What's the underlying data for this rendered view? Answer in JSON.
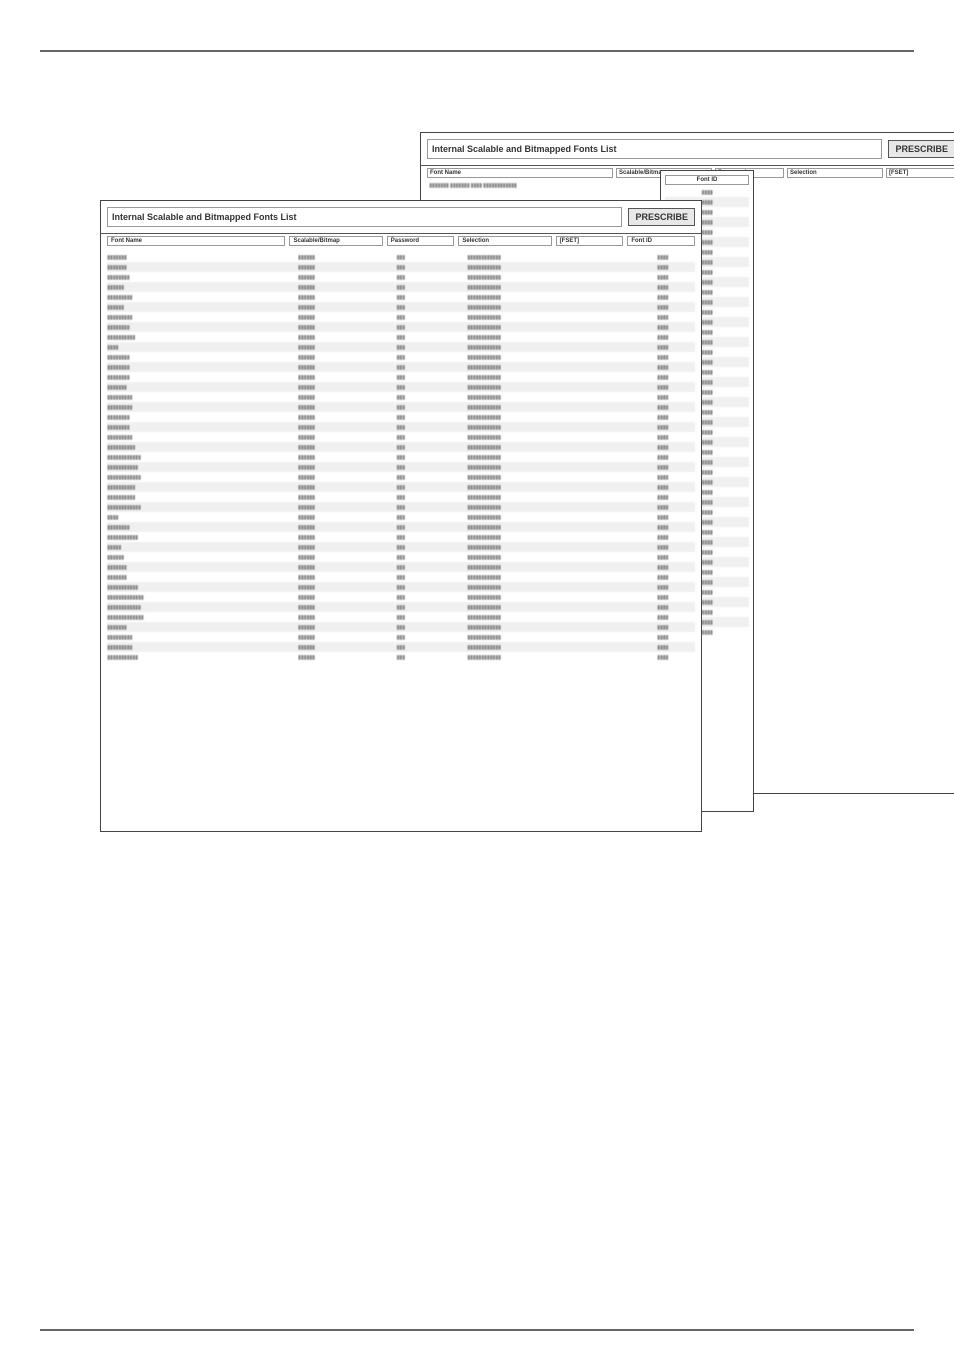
{
  "title": "Internal Scalable and Bitmapped Fonts List",
  "prescribe": "PRESCRIBE",
  "headers": {
    "name": "Font Name",
    "sb": "Scalable/Bitmap",
    "pw": "Password",
    "sel": "Selection",
    "fset": "[FSET]",
    "fid": "Font ID"
  },
  "rows": [
    {
      "name": "▮▮▮▮▮▮▮",
      "sb": "▮▮▮▮▮▮",
      "pw": "▮▮▮",
      "sel": "▮▮▮▮▮▮▮▮▮▮▮▮",
      "fid": "▮▮▮▮"
    },
    {
      "name": "▮▮▮▮▮▮▮",
      "sb": "▮▮▮▮▮▮",
      "pw": "▮▮▮",
      "sel": "▮▮▮▮▮▮▮▮▮▮▮▮",
      "fid": "▮▮▮▮"
    },
    {
      "name": "▮▮▮▮▮▮▮▮",
      "sb": "▮▮▮▮▮▮",
      "pw": "▮▮▮",
      "sel": "▮▮▮▮▮▮▮▮▮▮▮▮",
      "fid": "▮▮▮▮"
    },
    {
      "name": "▮▮▮▮▮▮",
      "sb": "▮▮▮▮▮▮",
      "pw": "▮▮▮",
      "sel": "▮▮▮▮▮▮▮▮▮▮▮▮",
      "fid": "▮▮▮▮"
    },
    {
      "name": "▮▮▮▮▮▮▮▮▮",
      "sb": "▮▮▮▮▮▮",
      "pw": "▮▮▮",
      "sel": "▮▮▮▮▮▮▮▮▮▮▮▮",
      "fid": "▮▮▮▮"
    },
    {
      "name": "▮▮▮▮▮▮",
      "sb": "▮▮▮▮▮▮",
      "pw": "▮▮▮",
      "sel": "▮▮▮▮▮▮▮▮▮▮▮▮",
      "fid": "▮▮▮▮"
    },
    {
      "name": "▮▮▮▮▮▮▮▮▮",
      "sb": "▮▮▮▮▮▮",
      "pw": "▮▮▮",
      "sel": "▮▮▮▮▮▮▮▮▮▮▮▮",
      "fid": "▮▮▮▮"
    },
    {
      "name": "▮▮▮▮▮▮▮▮",
      "sb": "▮▮▮▮▮▮",
      "pw": "▮▮▮",
      "sel": "▮▮▮▮▮▮▮▮▮▮▮▮",
      "fid": "▮▮▮▮"
    },
    {
      "name": "▮▮▮▮▮▮▮▮▮▮",
      "sb": "▮▮▮▮▮▮",
      "pw": "▮▮▮",
      "sel": "▮▮▮▮▮▮▮▮▮▮▮▮",
      "fid": "▮▮▮▮"
    },
    {
      "name": "▮▮▮▮",
      "sb": "▮▮▮▮▮▮",
      "pw": "▮▮▮",
      "sel": "▮▮▮▮▮▮▮▮▮▮▮▮",
      "fid": "▮▮▮▮"
    },
    {
      "name": "▮▮▮▮▮▮▮▮",
      "sb": "▮▮▮▮▮▮",
      "pw": "▮▮▮",
      "sel": "▮▮▮▮▮▮▮▮▮▮▮▮",
      "fid": "▮▮▮▮"
    },
    {
      "name": "▮▮▮▮▮▮▮▮",
      "sb": "▮▮▮▮▮▮",
      "pw": "▮▮▮",
      "sel": "▮▮▮▮▮▮▮▮▮▮▮▮",
      "fid": "▮▮▮▮"
    },
    {
      "name": "▮▮▮▮▮▮▮▮",
      "sb": "▮▮▮▮▮▮",
      "pw": "▮▮▮",
      "sel": "▮▮▮▮▮▮▮▮▮▮▮▮",
      "fid": "▮▮▮▮"
    },
    {
      "name": "▮▮▮▮▮▮▮",
      "sb": "▮▮▮▮▮▮",
      "pw": "▮▮▮",
      "sel": "▮▮▮▮▮▮▮▮▮▮▮▮",
      "fid": "▮▮▮▮"
    },
    {
      "name": "▮▮▮▮▮▮▮▮▮",
      "sb": "▮▮▮▮▮▮",
      "pw": "▮▮▮",
      "sel": "▮▮▮▮▮▮▮▮▮▮▮▮",
      "fid": "▮▮▮▮"
    },
    {
      "name": "▮▮▮▮▮▮▮▮▮",
      "sb": "▮▮▮▮▮▮",
      "pw": "▮▮▮",
      "sel": "▮▮▮▮▮▮▮▮▮▮▮▮",
      "fid": "▮▮▮▮"
    },
    {
      "name": "▮▮▮▮▮▮▮▮",
      "sb": "▮▮▮▮▮▮",
      "pw": "▮▮▮",
      "sel": "▮▮▮▮▮▮▮▮▮▮▮▮",
      "fid": "▮▮▮▮"
    },
    {
      "name": "▮▮▮▮▮▮▮▮",
      "sb": "▮▮▮▮▮▮",
      "pw": "▮▮▮",
      "sel": "▮▮▮▮▮▮▮▮▮▮▮▮",
      "fid": "▮▮▮▮"
    },
    {
      "name": "▮▮▮▮▮▮▮▮▮",
      "sb": "▮▮▮▮▮▮",
      "pw": "▮▮▮",
      "sel": "▮▮▮▮▮▮▮▮▮▮▮▮",
      "fid": "▮▮▮▮"
    },
    {
      "name": "▮▮▮▮▮▮▮▮▮▮",
      "sb": "▮▮▮▮▮▮",
      "pw": "▮▮▮",
      "sel": "▮▮▮▮▮▮▮▮▮▮▮▮",
      "fid": "▮▮▮▮"
    },
    {
      "name": "▮▮▮▮▮▮▮▮▮▮▮▮",
      "sb": "▮▮▮▮▮▮",
      "pw": "▮▮▮",
      "sel": "▮▮▮▮▮▮▮▮▮▮▮▮",
      "fid": "▮▮▮▮"
    },
    {
      "name": "▮▮▮▮▮▮▮▮▮▮▮",
      "sb": "▮▮▮▮▮▮",
      "pw": "▮▮▮",
      "sel": "▮▮▮▮▮▮▮▮▮▮▮▮",
      "fid": "▮▮▮▮"
    },
    {
      "name": "▮▮▮▮▮▮▮▮▮▮▮▮",
      "sb": "▮▮▮▮▮▮",
      "pw": "▮▮▮",
      "sel": "▮▮▮▮▮▮▮▮▮▮▮▮",
      "fid": "▮▮▮▮"
    },
    {
      "name": "▮▮▮▮▮▮▮▮▮▮",
      "sb": "▮▮▮▮▮▮",
      "pw": "▮▮▮",
      "sel": "▮▮▮▮▮▮▮▮▮▮▮▮",
      "fid": "▮▮▮▮"
    },
    {
      "name": "▮▮▮▮▮▮▮▮▮▮",
      "sb": "▮▮▮▮▮▮",
      "pw": "▮▮▮",
      "sel": "▮▮▮▮▮▮▮▮▮▮▮▮",
      "fid": "▮▮▮▮"
    },
    {
      "name": "▮▮▮▮▮▮▮▮▮▮▮▮",
      "sb": "▮▮▮▮▮▮",
      "pw": "▮▮▮",
      "sel": "▮▮▮▮▮▮▮▮▮▮▮▮",
      "fid": "▮▮▮▮"
    },
    {
      "name": "▮▮▮▮",
      "sb": "▮▮▮▮▮▮",
      "pw": "▮▮▮",
      "sel": "▮▮▮▮▮▮▮▮▮▮▮▮",
      "fid": "▮▮▮▮"
    },
    {
      "name": "▮▮▮▮▮▮▮▮",
      "sb": "▮▮▮▮▮▮",
      "pw": "▮▮▮",
      "sel": "▮▮▮▮▮▮▮▮▮▮▮▮",
      "fid": "▮▮▮▮"
    },
    {
      "name": "▮▮▮▮▮▮▮▮▮▮▮",
      "sb": "▮▮▮▮▮▮",
      "pw": "▮▮▮",
      "sel": "▮▮▮▮▮▮▮▮▮▮▮▮",
      "fid": "▮▮▮▮"
    },
    {
      "name": "▮▮▮▮▮",
      "sb": "▮▮▮▮▮▮",
      "pw": "▮▮▮",
      "sel": "▮▮▮▮▮▮▮▮▮▮▮▮",
      "fid": "▮▮▮▮"
    },
    {
      "name": "▮▮▮▮▮▮",
      "sb": "▮▮▮▮▮▮",
      "pw": "▮▮▮",
      "sel": "▮▮▮▮▮▮▮▮▮▮▮▮",
      "fid": "▮▮▮▮"
    },
    {
      "name": "▮▮▮▮▮▮▮",
      "sb": "▮▮▮▮▮▮",
      "pw": "▮▮▮",
      "sel": "▮▮▮▮▮▮▮▮▮▮▮▮",
      "fid": "▮▮▮▮"
    },
    {
      "name": "▮▮▮▮▮▮▮",
      "sb": "▮▮▮▮▮▮",
      "pw": "▮▮▮",
      "sel": "▮▮▮▮▮▮▮▮▮▮▮▮",
      "fid": "▮▮▮▮"
    },
    {
      "name": "▮▮▮▮▮▮▮▮▮▮▮",
      "sb": "▮▮▮▮▮▮",
      "pw": "▮▮▮",
      "sel": "▮▮▮▮▮▮▮▮▮▮▮▮",
      "fid": "▮▮▮▮"
    },
    {
      "name": "▮▮▮▮▮▮▮▮▮▮▮▮▮",
      "sb": "▮▮▮▮▮▮",
      "pw": "▮▮▮",
      "sel": "▮▮▮▮▮▮▮▮▮▮▮▮",
      "fid": "▮▮▮▮"
    },
    {
      "name": "▮▮▮▮▮▮▮▮▮▮▮▮",
      "sb": "▮▮▮▮▮▮",
      "pw": "▮▮▮",
      "sel": "▮▮▮▮▮▮▮▮▮▮▮▮",
      "fid": "▮▮▮▮"
    },
    {
      "name": "▮▮▮▮▮▮▮▮▮▮▮▮▮",
      "sb": "▮▮▮▮▮▮",
      "pw": "▮▮▮",
      "sel": "▮▮▮▮▮▮▮▮▮▮▮▮",
      "fid": "▮▮▮▮"
    },
    {
      "name": "▮▮▮▮▮▮▮",
      "sb": "▮▮▮▮▮▮",
      "pw": "▮▮▮",
      "sel": "▮▮▮▮▮▮▮▮▮▮▮▮",
      "fid": "▮▮▮▮"
    },
    {
      "name": "▮▮▮▮▮▮▮▮▮",
      "sb": "▮▮▮▮▮▮",
      "pw": "▮▮▮",
      "sel": "▮▮▮▮▮▮▮▮▮▮▮▮",
      "fid": "▮▮▮▮"
    },
    {
      "name": "▮▮▮▮▮▮▮▮▮",
      "sb": "▮▮▮▮▮▮",
      "pw": "▮▮▮",
      "sel": "▮▮▮▮▮▮▮▮▮▮▮▮",
      "fid": "▮▮▮▮"
    },
    {
      "name": "▮▮▮▮▮▮▮▮▮▮▮",
      "sb": "▮▮▮▮▮▮",
      "pw": "▮▮▮",
      "sel": "▮▮▮▮▮▮▮▮▮▮▮▮",
      "fid": "▮▮▮▮"
    }
  ],
  "back_row": "▮▮▮▮▮▮▮                           ▮▮▮▮▮▮▮        ▮▮▮▮      ▮▮▮▮▮▮▮▮▮▮▮▮",
  "front_rows": [
    "▮▮▮▮",
    "▮▮▮▮",
    "▮▮▮▮",
    "▮▮▮▮",
    "▮▮▮▮",
    "▮▮▮▮",
    "▮▮▮▮",
    "▮▮▮▮",
    "▮▮▮▮",
    "▮▮▮▮",
    "▮▮▮▮",
    "▮▮▮▮",
    "▮▮▮▮",
    "▮▮▮▮",
    "▮▮▮▮",
    "▮▮▮▮",
    "▮▮▮▮",
    "▮▮▮▮",
    "▮▮▮▮",
    "▮▮▮▮",
    "▮▮▮▮",
    "▮▮▮▮",
    "▮▮▮▮",
    "▮▮▮▮",
    "▮▮▮▮",
    "▮▮▮▮",
    "▮▮▮▮",
    "▮▮▮▮",
    "▮▮▮▮",
    "▮▮▮▮",
    "▮▮▮▮",
    "▮▮▮▮",
    "▮▮▮▮",
    "▮▮▮▮",
    "▮▮▮▮",
    "▮▮▮▮",
    "▮▮▮▮",
    "▮▮▮▮",
    "▮▮▮▮",
    "▮▮▮▮",
    "▮▮▮▮",
    "▮▮▮▮",
    "▮▮▮▮",
    "▮▮▮▮",
    "▮▮▮▮"
  ]
}
